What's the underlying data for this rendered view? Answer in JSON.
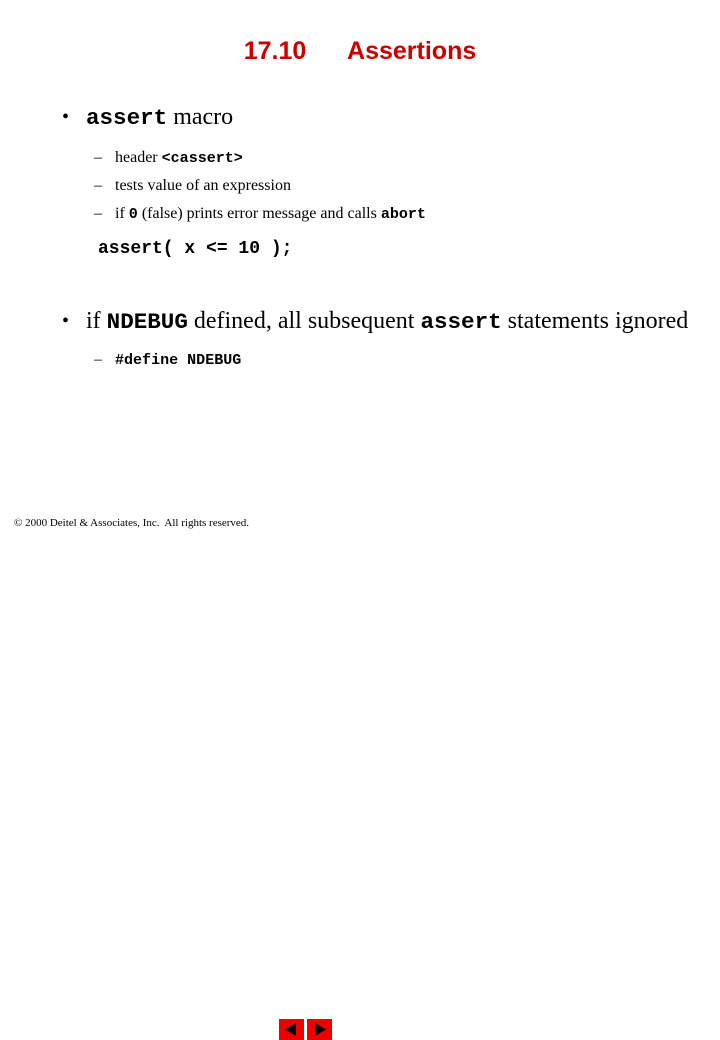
{
  "slide": {
    "title": "17.10      Assertions",
    "bullets": [
      {
        "marker": "•",
        "segments": [
          {
            "text": "assert",
            "style": "mono"
          },
          {
            "text": " macro",
            "style": "serif"
          }
        ],
        "subitems": [
          {
            "marker": "–",
            "segments": [
              {
                "text": "header ",
                "style": "serif"
              },
              {
                "text": "<cassert>",
                "style": "mono"
              }
            ]
          },
          {
            "marker": "–",
            "segments": [
              {
                "text": "tests value of an expression",
                "style": "serif"
              }
            ]
          },
          {
            "marker": "–",
            "segments": [
              {
                "text": "if ",
                "style": "serif"
              },
              {
                "text": "0",
                "style": "mono"
              },
              {
                "text": " (false) prints error message and calls ",
                "style": "serif"
              },
              {
                "text": "abort",
                "style": "mono"
              }
            ]
          }
        ],
        "code": "assert( x <= 10 );"
      },
      {
        "marker": "•",
        "segments": [
          {
            "text": "if ",
            "style": "serif"
          },
          {
            "text": "NDEBUG",
            "style": "mono"
          },
          {
            "text": " defined, all subsequent ",
            "style": "serif"
          },
          {
            "text": "assert",
            "style": "mono"
          },
          {
            "text": " statements ignored",
            "style": "serif"
          }
        ],
        "subitems": [
          {
            "marker": "–",
            "segments": [
              {
                "text": "#define NDEBUG",
                "style": "mono"
              }
            ]
          }
        ]
      }
    ]
  },
  "footer": {
    "copyright": "© 2000 Deitel & Associates, Inc.  All rights reserved.",
    "prev_button": "previous-slide",
    "next_button": "next-slide"
  },
  "colors": {
    "title": "#cc0000",
    "nav_button": "#ee0000",
    "text": "#000000",
    "background": "#ffffff"
  }
}
